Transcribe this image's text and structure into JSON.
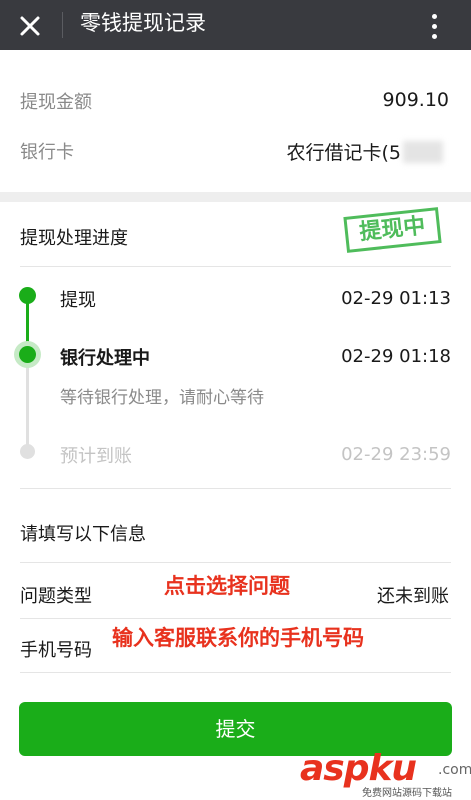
{
  "header": {
    "title": "零钱提现记录",
    "close_icon": "close-icon",
    "more_icon": "more-vertical-icon"
  },
  "summary": {
    "amount_label": "提现金额",
    "amount_value": "909.10",
    "card_label": "银行卡",
    "card_value": "农行借记卡(5"
  },
  "progress": {
    "title": "提现处理进度",
    "stamp": "提现中",
    "steps": [
      {
        "label": "提现",
        "time": "02-29 01:13",
        "state": "done"
      },
      {
        "label": "银行处理中",
        "time": "02-29 01:18",
        "state": "current",
        "note": "等待银行处理，请耐心等待"
      },
      {
        "label": "预计到账",
        "time": "02-29 23:59",
        "state": "pending"
      }
    ]
  },
  "form": {
    "title": "请填写以下信息",
    "fields": [
      {
        "label": "问题类型",
        "value": "还未到账",
        "annotation": "点击选择问题"
      },
      {
        "label": "手机号码",
        "value": "",
        "annotation": "输入客服联系你的手机号码"
      }
    ],
    "submit_label": "提交"
  },
  "watermark": {
    "main": "aspku",
    "suffix": ".com",
    "sub": "免费网站源码下载站"
  },
  "colors": {
    "accent": "#1aad19",
    "annotation": "#e8321e",
    "topbar": "#393a3f"
  }
}
